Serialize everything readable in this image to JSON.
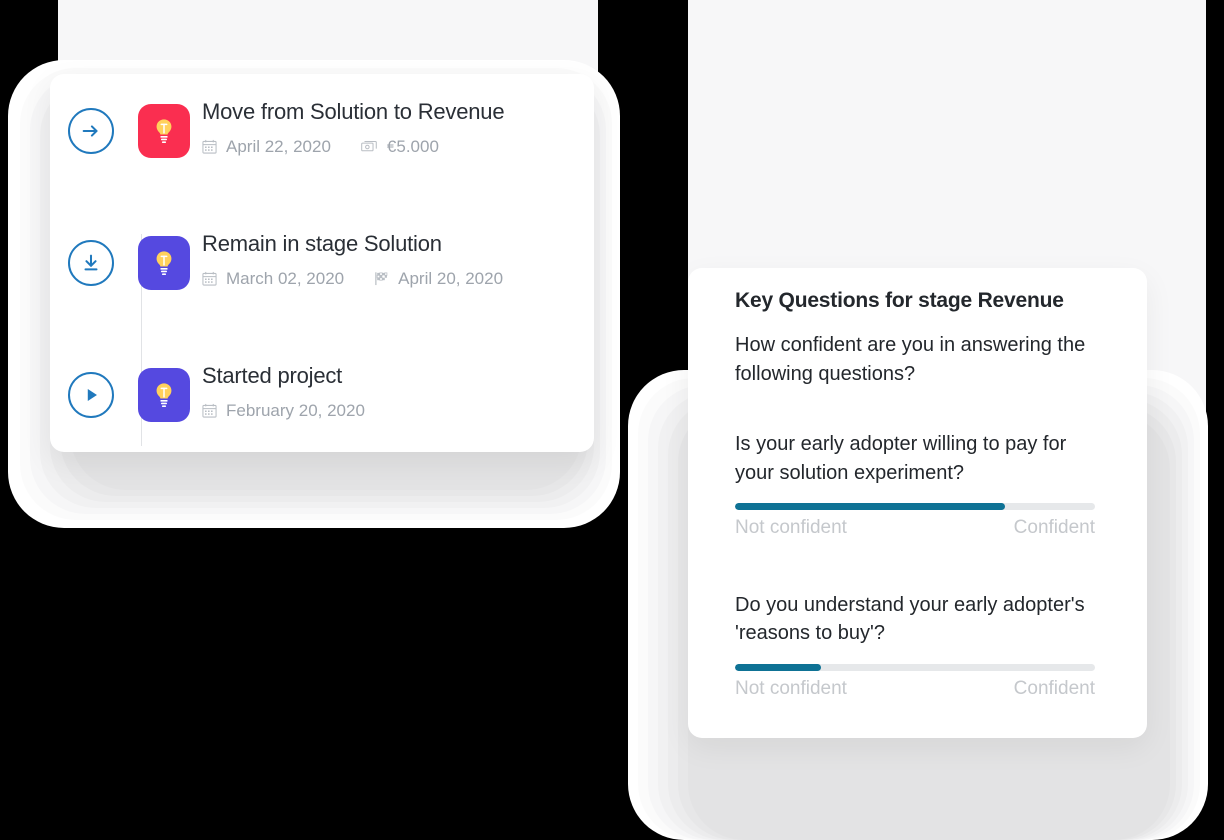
{
  "colors": {
    "accent_blue": "#2079bd",
    "badge_red": "#fa2e50",
    "badge_purple": "#5549e0",
    "progress_fill": "#0e7295",
    "progress_track": "#e6e8ea",
    "muted_text": "#9ea4ac",
    "page_background": "#f7f7f8"
  },
  "timeline": {
    "items": [
      {
        "marker_icon": "arrow-right-circle-icon",
        "badge_icon": "lightbulb-icon",
        "badge_color": "#fa2e50",
        "title": "Move from Solution to Revenue",
        "meta": [
          {
            "icon": "calendar-icon",
            "value": "April 22, 2020"
          },
          {
            "icon": "money-icon",
            "value": "€5.000"
          }
        ]
      },
      {
        "marker_icon": "arrow-down-circle-icon",
        "badge_icon": "lightbulb-icon",
        "badge_color": "#5549e0",
        "title": "Remain in stage Solution",
        "meta": [
          {
            "icon": "calendar-icon",
            "value": "March 02, 2020"
          },
          {
            "icon": "checkered-flag-icon",
            "value": "April 20, 2020"
          }
        ]
      },
      {
        "marker_icon": "play-circle-icon",
        "badge_icon": "lightbulb-icon",
        "badge_color": "#5549e0",
        "title": "Started project",
        "meta": [
          {
            "icon": "calendar-icon",
            "value": "February 20, 2020"
          }
        ]
      }
    ]
  },
  "questions_card": {
    "heading": "Key Questions for stage Revenue",
    "lead": "How confident are you in answering the following questions?",
    "scale_low_label": "Not confident",
    "scale_high_label": "Confident",
    "questions": [
      {
        "text": "Is your early adopter willing to pay for your solution experiment?",
        "confidence_percent": 75,
        "low_label": "Not confident",
        "high_label": "Confident"
      },
      {
        "text": "Do you understand your early adopter's 'reasons to buy'?",
        "confidence_percent": 24,
        "low_label": "Not confident",
        "high_label": "Confident"
      }
    ]
  }
}
